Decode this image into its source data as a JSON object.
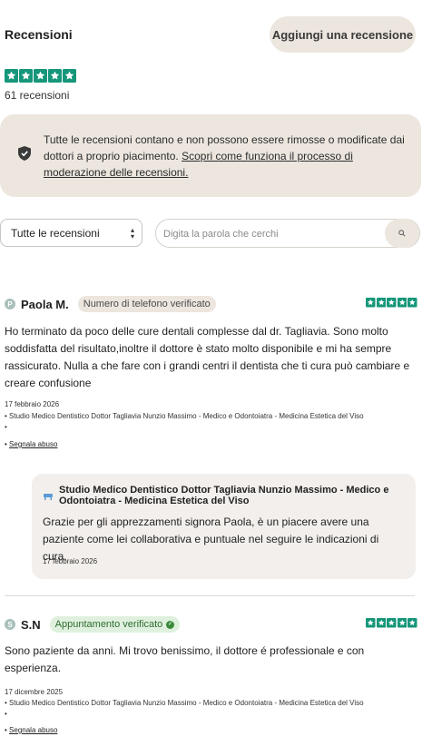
{
  "header": {
    "title": "Recensioni",
    "add_review_label": "Aggiungi una recensione"
  },
  "summary": {
    "rating_stars": 5,
    "reviews_count": "61 recensioni"
  },
  "info": {
    "text": "Tutte le recensioni contano e non possono essere rimosse o modificate dai dottori a proprio piacimento.",
    "link": "Scopri come funziona il processo di moderazione delle recensioni."
  },
  "filters": {
    "select_value": "Tutte le recensioni",
    "search_placeholder": "Digita la parola che cerchi"
  },
  "reviews": [
    {
      "avatar_letter": "P",
      "author": "Paola M.",
      "badge": "Numero di telefono verificato",
      "stars": 5,
      "text": "Ho terminato da poco delle cure dentali complesse dal dr. Tagliavia. Sono molto soddisfatta del risultato,inoltre il dottore è stato molto disponibile e mi ha sempre rassicurato. Nulla a che fare con i grandi centri il dentista che ti cura può cambiare e creare confusione",
      "date": "17 febbraio 2026",
      "clinic": "• Studio Medico Dentistico Dottor Tagliavia Nunzio Massimo - Medico e Odontoiatra - Medicina Estetica del Viso",
      "bullet": "•",
      "abuse_prefix": "• ",
      "abuse_link": "Segnala abuso",
      "reply": {
        "name": "Studio Medico Dentistico Dottor Tagliavia Nunzio Massimo - Medico e Odontoiatra - Medicina Estetica del Viso",
        "text": "Grazie per gli apprezzamenti signora Paola, è un piacere avere una paziente come lei collaborativa e puntuale nel seguire le indicazioni di cura.",
        "date": "17 febbraio 2026"
      }
    },
    {
      "avatar_letter": "S",
      "author": "S.N",
      "badge": "Appuntamento verificato",
      "stars": 5,
      "text": "Sono paziente da anni. Mi trovo benissimo, il dottore é professionale e con esperienza.",
      "date": "17 dicembre 2025",
      "clinic": "• Studio Medico Dentistico Dottor Tagliavia Nunzio Massimo - Medico e Odontoiatra - Medicina Estetica del Viso",
      "bullet": "•",
      "abuse_prefix": "• ",
      "abuse_link": "Segnala abuso"
    }
  ],
  "colors": {
    "star": "#16967a",
    "accent_bg": "#ece6df",
    "verified_green": "#3b8a3b"
  }
}
